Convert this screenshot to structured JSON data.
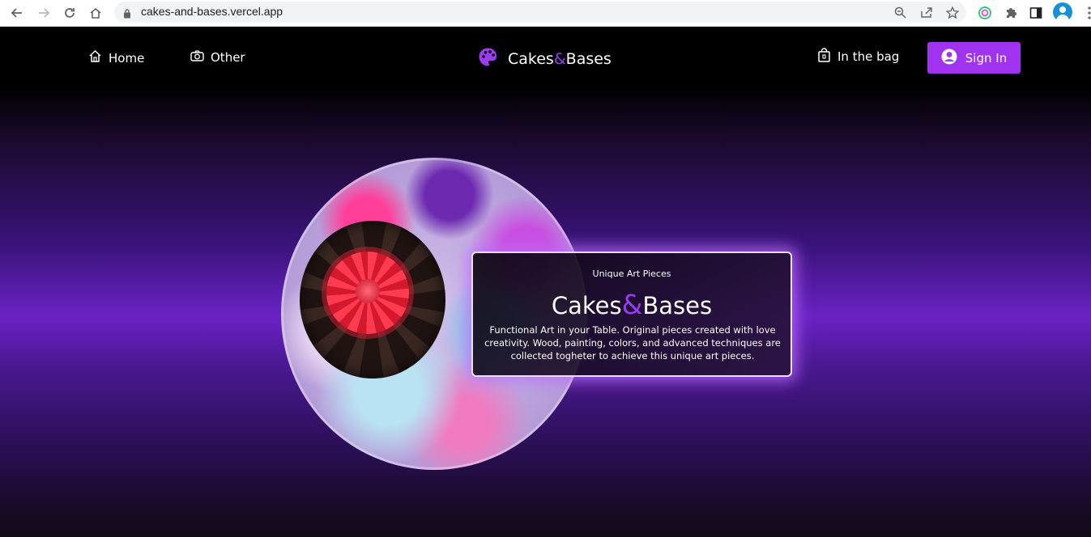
{
  "browser": {
    "url": "cakes-and-bases.vercel.app"
  },
  "nav": {
    "home": "Home",
    "other": "Other",
    "brand_part1": "Cakes",
    "brand_amp": "&",
    "brand_part2": "Bases",
    "bag": "In the bag",
    "signin": "Sign In"
  },
  "hero": {
    "kicker": "Unique Art Pieces",
    "title_part1": "Cakes",
    "title_amp": "&",
    "title_part2": "Bases",
    "description": "Functional Art in your Table. Original pieces created with love creativity. Wood, painting, colors, and advanced techniques are collected togheter to achieve this unique art pieces."
  },
  "colors": {
    "accent": "#a033ef",
    "brand_amp": "#9b3cf0"
  }
}
